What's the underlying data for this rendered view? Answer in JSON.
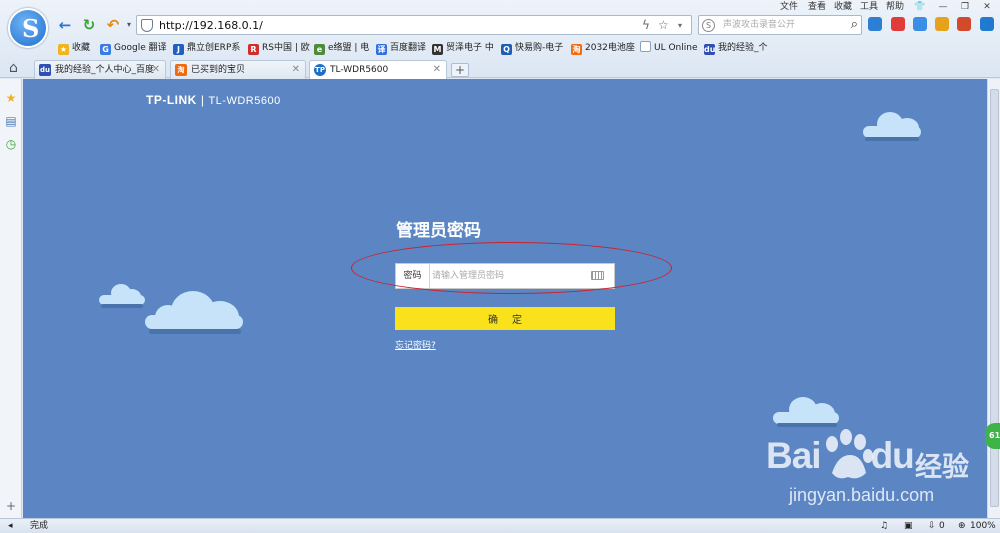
{
  "browser": {
    "menu": [
      "文件",
      "查看",
      "收藏",
      "工具",
      "帮助"
    ],
    "address": {
      "url": "http://192.168.0.1/"
    },
    "search": {
      "placeholder": "声波攻击录音公开"
    },
    "bookmarks": [
      {
        "label": "收藏",
        "icon": "star-icon"
      },
      {
        "label": "Google 翻译",
        "icon": "google-translate-icon"
      },
      {
        "label": "鼎立创ERP系",
        "icon": "erp-icon"
      },
      {
        "label": "RS中国 | 欧",
        "icon": "rs-icon"
      },
      {
        "label": "e络盟 | 电",
        "icon": "element14-icon"
      },
      {
        "label": "百度翻译",
        "icon": "baidu-translate-icon"
      },
      {
        "label": "贸泽电子 中",
        "icon": "mouser-icon"
      },
      {
        "label": "快易购-电子",
        "icon": "kuaiyigou-icon"
      },
      {
        "label": "2032电池座",
        "icon": "taobao-icon"
      },
      {
        "label": "UL Online",
        "icon": "document-icon"
      },
      {
        "label": "我的经验_个",
        "icon": "baidu-paw-icon"
      }
    ],
    "tabs": [
      {
        "title": "我的经验_个人中心_百度",
        "active": false
      },
      {
        "title": "已买到的宝贝",
        "active": false
      },
      {
        "title": "TL-WDR5600",
        "active": true
      }
    ],
    "status": {
      "text": "完成",
      "count": "0",
      "zoom": "100%"
    },
    "side_badge": "61"
  },
  "page": {
    "brand": {
      "logo": "TP-LINK",
      "separator": "|",
      "model": "TL-WDR5600"
    },
    "login": {
      "title": "管理员密码",
      "password_label": "密码",
      "password_placeholder": "请输入管理员密码",
      "password_value": "",
      "confirm_label": "确定",
      "forgot_link": "忘记密码?"
    },
    "watermark": {
      "brand": "Bai",
      "brand_suffix": "du",
      "suffix_cn": "经验",
      "url": "jingyan.baidu.com"
    },
    "colors": {
      "background": "#5b86c3",
      "confirm_button": "#f9e21b",
      "cloud": "#c7e3fa",
      "annotation_ring": "#cf1f2b"
    }
  }
}
